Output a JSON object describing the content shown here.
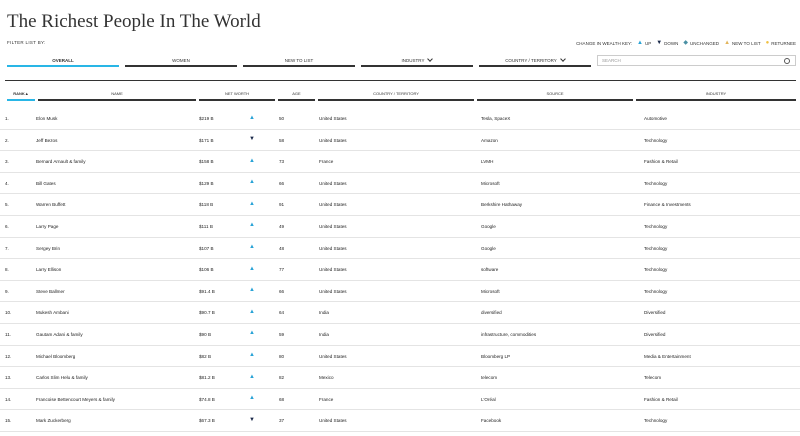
{
  "page": {
    "title": "The Richest People In The World"
  },
  "filter": {
    "label": "FILTER LIST BY:"
  },
  "key": {
    "label": "CHANGE IN WEALTH KEY:",
    "items": [
      {
        "symbol": "▲",
        "label": "UP",
        "color": "#29a3d6"
      },
      {
        "symbol": "▼",
        "label": "DOWN",
        "color": "#1b2a4a"
      },
      {
        "symbol": "◆",
        "label": "UNCHANGED",
        "color": "#4a90a4"
      },
      {
        "symbol": "▲",
        "label": "NEW TO LIST",
        "color": "#e2b45c"
      },
      {
        "symbol": "●",
        "label": "RETURNEE",
        "color": "#f0c040"
      }
    ]
  },
  "tabs": [
    {
      "label": "OVERALL",
      "active": true
    },
    {
      "label": "WOMEN"
    },
    {
      "label": "NEW TO LIST"
    },
    {
      "label": "INDUSTRY",
      "dropdown": true
    },
    {
      "label": "COUNTRY / TERRITORY",
      "dropdown": true
    }
  ],
  "search": {
    "placeholder": "SEARCH"
  },
  "columns": [
    "RANK",
    "NAME",
    "NET WORTH",
    "AGE",
    "COUNTRY / TERRITORY",
    "SOURCE",
    "INDUSTRY"
  ],
  "sort": {
    "column": "RANK",
    "indicator": "▲"
  },
  "accent_color": "#29b6e6",
  "rows": [
    {
      "rank": "1.",
      "name": "Elon Musk",
      "worth": "$219 B",
      "change": "up",
      "age": "50",
      "country": "United States",
      "source": "Tesla, SpaceX",
      "industry": "Automotive"
    },
    {
      "rank": "2.",
      "name": "Jeff Bezos",
      "worth": "$171 B",
      "change": "down",
      "age": "58",
      "country": "United States",
      "source": "Amazon",
      "industry": "Technology"
    },
    {
      "rank": "3.",
      "name": "Bernard Arnault & family",
      "worth": "$158 B",
      "change": "up",
      "age": "73",
      "country": "France",
      "source": "LVMH",
      "industry": "Fashion & Retail"
    },
    {
      "rank": "4.",
      "name": "Bill Gates",
      "worth": "$129 B",
      "change": "up",
      "age": "66",
      "country": "United States",
      "source": "Microsoft",
      "industry": "Technology"
    },
    {
      "rank": "5.",
      "name": "Warren Buffett",
      "worth": "$118 B",
      "change": "up",
      "age": "91",
      "country": "United States",
      "source": "Berkshire Hathaway",
      "industry": "Finance & Investments"
    },
    {
      "rank": "6.",
      "name": "Larry Page",
      "worth": "$111 B",
      "change": "up",
      "age": "49",
      "country": "United States",
      "source": "Google",
      "industry": "Technology"
    },
    {
      "rank": "7.",
      "name": "Sergey Brin",
      "worth": "$107 B",
      "change": "up",
      "age": "48",
      "country": "United States",
      "source": "Google",
      "industry": "Technology"
    },
    {
      "rank": "8.",
      "name": "Larry Ellison",
      "worth": "$106 B",
      "change": "up",
      "age": "77",
      "country": "United States",
      "source": "software",
      "industry": "Technology"
    },
    {
      "rank": "9.",
      "name": "Steve Ballmer",
      "worth": "$91.4 B",
      "change": "up",
      "age": "66",
      "country": "United States",
      "source": "Microsoft",
      "industry": "Technology"
    },
    {
      "rank": "10.",
      "name": "Mukesh Ambani",
      "worth": "$90.7 B",
      "change": "up",
      "age": "64",
      "country": "India",
      "source": "diversified",
      "industry": "Diversified"
    },
    {
      "rank": "11.",
      "name": "Gautam Adani & family",
      "worth": "$90 B",
      "change": "up",
      "age": "59",
      "country": "India",
      "source": "infrastructure, commodities",
      "industry": "Diversified"
    },
    {
      "rank": "12.",
      "name": "Michael Bloomberg",
      "worth": "$82 B",
      "change": "up",
      "age": "80",
      "country": "United States",
      "source": "Bloomberg LP",
      "industry": "Media & Entertainment"
    },
    {
      "rank": "13.",
      "name": "Carlos Slim Helu & family",
      "worth": "$81.2 B",
      "change": "up",
      "age": "82",
      "country": "Mexico",
      "source": "telecom",
      "industry": "Telecom"
    },
    {
      "rank": "14.",
      "name": "Francoise Bettencourt Meyers & family",
      "worth": "$74.8 B",
      "change": "up",
      "age": "68",
      "country": "France",
      "source": "L'Oréal",
      "industry": "Fashion & Retail"
    },
    {
      "rank": "15.",
      "name": "Mark Zuckerberg",
      "worth": "$67.3 B",
      "change": "down",
      "age": "37",
      "country": "United States",
      "source": "Facebook",
      "industry": "Technology"
    }
  ]
}
